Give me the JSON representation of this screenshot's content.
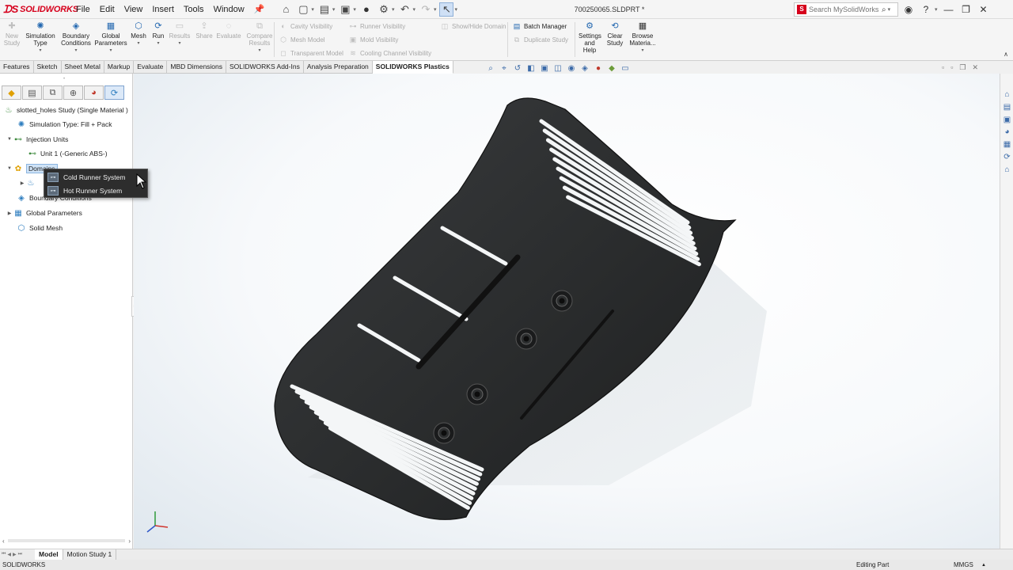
{
  "app": {
    "logo_text": "SOLIDWORKS",
    "doc_title": "700250065.SLDPRT *"
  },
  "menus": [
    "File",
    "Edit",
    "View",
    "Insert",
    "Tools",
    "Window"
  ],
  "search": {
    "placeholder": "Search MySolidWorks"
  },
  "ribbon": {
    "new_study": "New Study",
    "simulation_type": "Simulation Type",
    "boundary_conditions": "Boundary Conditions",
    "global_parameters": "Global Parameters",
    "mesh": "Mesh",
    "run": "Run",
    "results": "Results",
    "share": "Share",
    "evaluate": "Evaluate",
    "compare_results": "Compare Results",
    "cavity_visibility": "Cavity Visibility",
    "mesh_model": "Mesh Model",
    "transparent_model": "Transparent Model",
    "runner_visibility": "Runner Visibility",
    "mold_visibility": "Mold Visibility",
    "cooling_channel_visibility": "Cooling Channel Visibility",
    "show_hide_domain": "Show/Hide Domain",
    "batch_manager": "Batch Manager",
    "duplicate_study": "Duplicate Study",
    "settings_help": "Settings and Help",
    "clear_study": "Clear Study",
    "browse_materials": "Browse Materia..."
  },
  "command_tabs": [
    "Features",
    "Sketch",
    "Sheet Metal",
    "Markup",
    "Evaluate",
    "MBD Dimensions",
    "SOLIDWORKS Add-Ins",
    "Analysis Preparation",
    "SOLIDWORKS Plastics"
  ],
  "active_command_tab": "SOLIDWORKS Plastics",
  "tree": {
    "study": "slotted_holes Study (Single Material )",
    "simulation_type": "Simulation Type: Fill + Pack",
    "injection_units": "Injection Units",
    "unit1": "Unit 1 (-Generic ABS-)",
    "domains": "Domains",
    "boundary_conditions": "Boundary Conditions",
    "global_parameters": "Global Parameters",
    "solid_mesh": "Solid Mesh"
  },
  "context_menu": {
    "items": [
      "Cold Runner System",
      "Hot Runner System"
    ]
  },
  "bottom_tabs": [
    "Model",
    "Motion Study 1"
  ],
  "status": {
    "left": "SOLIDWORKS",
    "mode": "Editing Part",
    "units": "MMGS"
  },
  "colors": {
    "brand": "#d6001c",
    "part": "#2a2c2d",
    "context_menu_bg": "#2d2d2d"
  }
}
